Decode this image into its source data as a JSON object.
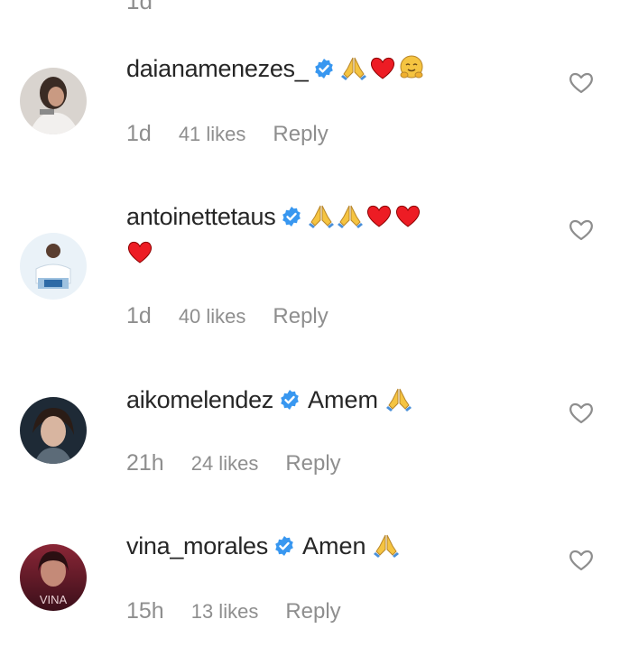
{
  "top_cut_text": "1d",
  "colors": {
    "username": "#262626",
    "meta": "#8e8e8e",
    "verified_blue": "#3897f0",
    "heart_red": "#ed1c24"
  },
  "comments": [
    {
      "username": "daianamenezes_",
      "verified": true,
      "text": "",
      "emojis": [
        "pray",
        "red-heart",
        "hugging-face"
      ],
      "time": "1d",
      "likes": "41 likes",
      "reply": "Reply"
    },
    {
      "username": "antoinettetaus",
      "verified": true,
      "text": "",
      "emojis": [
        "pray",
        "pray",
        "red-heart",
        "red-heart",
        "red-heart"
      ],
      "time": "1d",
      "likes": "40 likes",
      "reply": "Reply"
    },
    {
      "username": "aikomelendez",
      "verified": true,
      "text": "Amem",
      "emojis": [
        "pray"
      ],
      "time": "21h",
      "likes": "24 likes",
      "reply": "Reply"
    },
    {
      "username": "vina_morales",
      "verified": true,
      "text": "Amen",
      "emojis": [
        "pray"
      ],
      "time": "15h",
      "likes": "13 likes",
      "reply": "Reply"
    }
  ]
}
